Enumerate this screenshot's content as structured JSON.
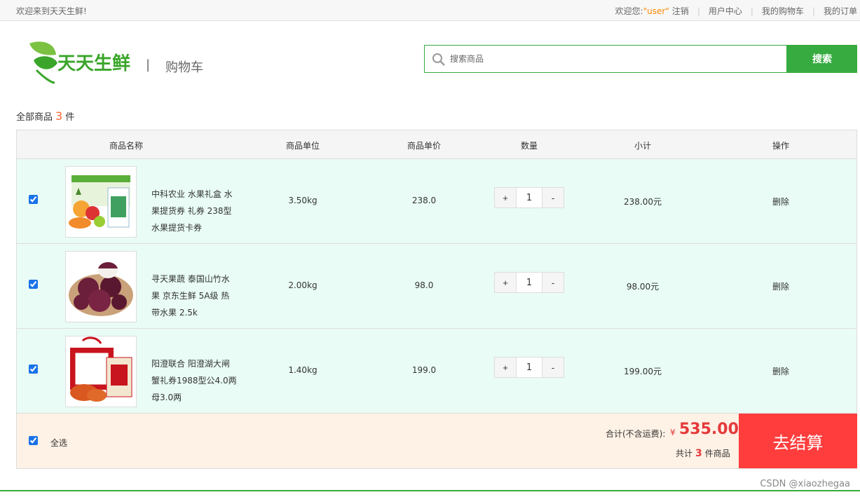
{
  "topbar": {
    "welcome": "欢迎来到天天生鲜!",
    "greeting": "欢迎您:",
    "username": "\"user\"",
    "logout": "注销",
    "links": [
      "用户中心",
      "我的购物车",
      "我的订单"
    ]
  },
  "header": {
    "logo_text": "天天生鲜",
    "separator": "|",
    "page_title": "购物车"
  },
  "search": {
    "placeholder": "搜索商品",
    "button": "搜索"
  },
  "summary": {
    "prefix": "全部商品",
    "count": "3",
    "suffix": "件"
  },
  "table": {
    "headers": [
      "商品名称",
      "商品单位",
      "商品单价",
      "数量",
      "小计",
      "操作"
    ],
    "rows": [
      {
        "name": "中科农业 水果礼盒 水果提货券 礼券 238型 水果提货卡券",
        "unit": "3.50kg",
        "price": "238.0",
        "qty": "1",
        "subtotal": "238.00元",
        "action": "删除",
        "thumb": "fruit-gift-box"
      },
      {
        "name": "寻天果蔬 泰国山竹水果 京东生鲜 5A级 热带水果 2.5k",
        "unit": "2.00kg",
        "price": "98.0",
        "qty": "1",
        "subtotal": "98.00元",
        "action": "删除",
        "thumb": "mangosteen"
      },
      {
        "name": "阳澄联合 阳澄湖大闸蟹礼券1988型公4.0两母3.0两",
        "unit": "1.40kg",
        "price": "199.0",
        "qty": "1",
        "subtotal": "199.00元",
        "action": "删除",
        "thumb": "crab-gift-box"
      }
    ],
    "plus": "+",
    "minus": "-"
  },
  "footer": {
    "select_all": "全选",
    "total_label": "合计(不含运费):",
    "currency": "¥",
    "total_value": "535.00",
    "count_prefix": "共计",
    "count": "3",
    "count_suffix": "件商品",
    "checkout": "去结算"
  },
  "watermark": "CSDN @xiaozhegaa",
  "colors": {
    "brand_green": "#37ab40",
    "price_red": "#e4393c",
    "checkout_red": "#ff3d3d",
    "row_bg": "#e9fcf5",
    "footer_bg": "#fef1e5"
  }
}
